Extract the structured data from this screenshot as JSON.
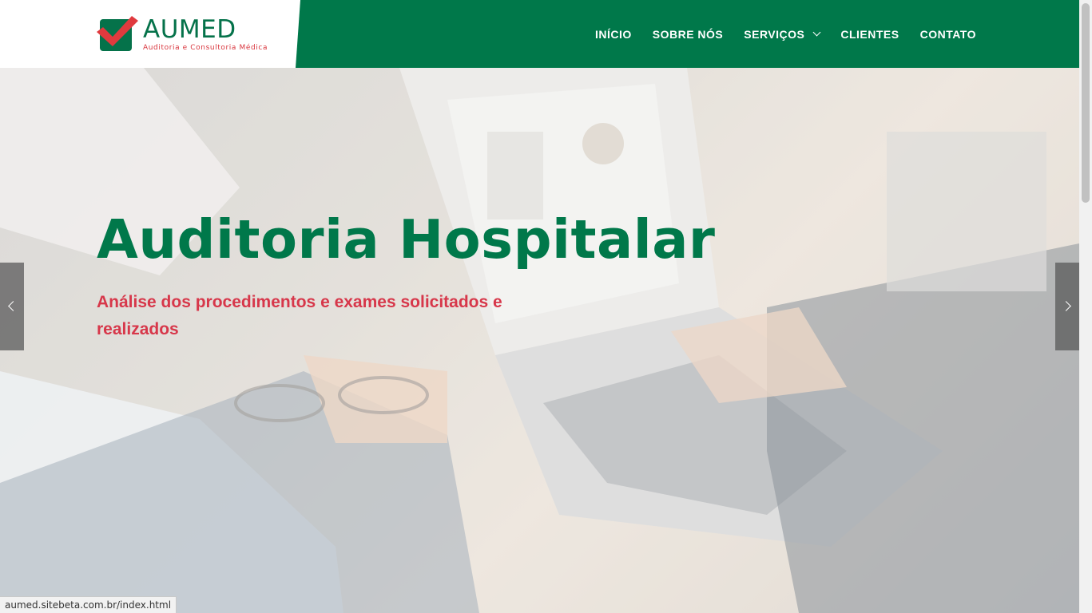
{
  "brand": {
    "name": "AUMED",
    "tagline": "Auditoria e Consultoria Médica",
    "primary_color": "#00784a",
    "accent_color": "#d7374a"
  },
  "nav": {
    "items": [
      {
        "label": "INÍCIO"
      },
      {
        "label": "SOBRE NÓS"
      },
      {
        "label": "SERVIÇOS",
        "icon": "chevron-down-icon"
      },
      {
        "label": "CLIENTES"
      },
      {
        "label": "CONTATO"
      }
    ]
  },
  "hero": {
    "title": "Auditoria Hospitalar",
    "subtitle": "Análise dos procedimentos e exames solicitados e realizados",
    "prev_icon": "chevron-left-icon",
    "next_icon": "chevron-right-icon"
  },
  "status_bar": {
    "url": "aumed.sitebeta.com.br/index.html"
  }
}
